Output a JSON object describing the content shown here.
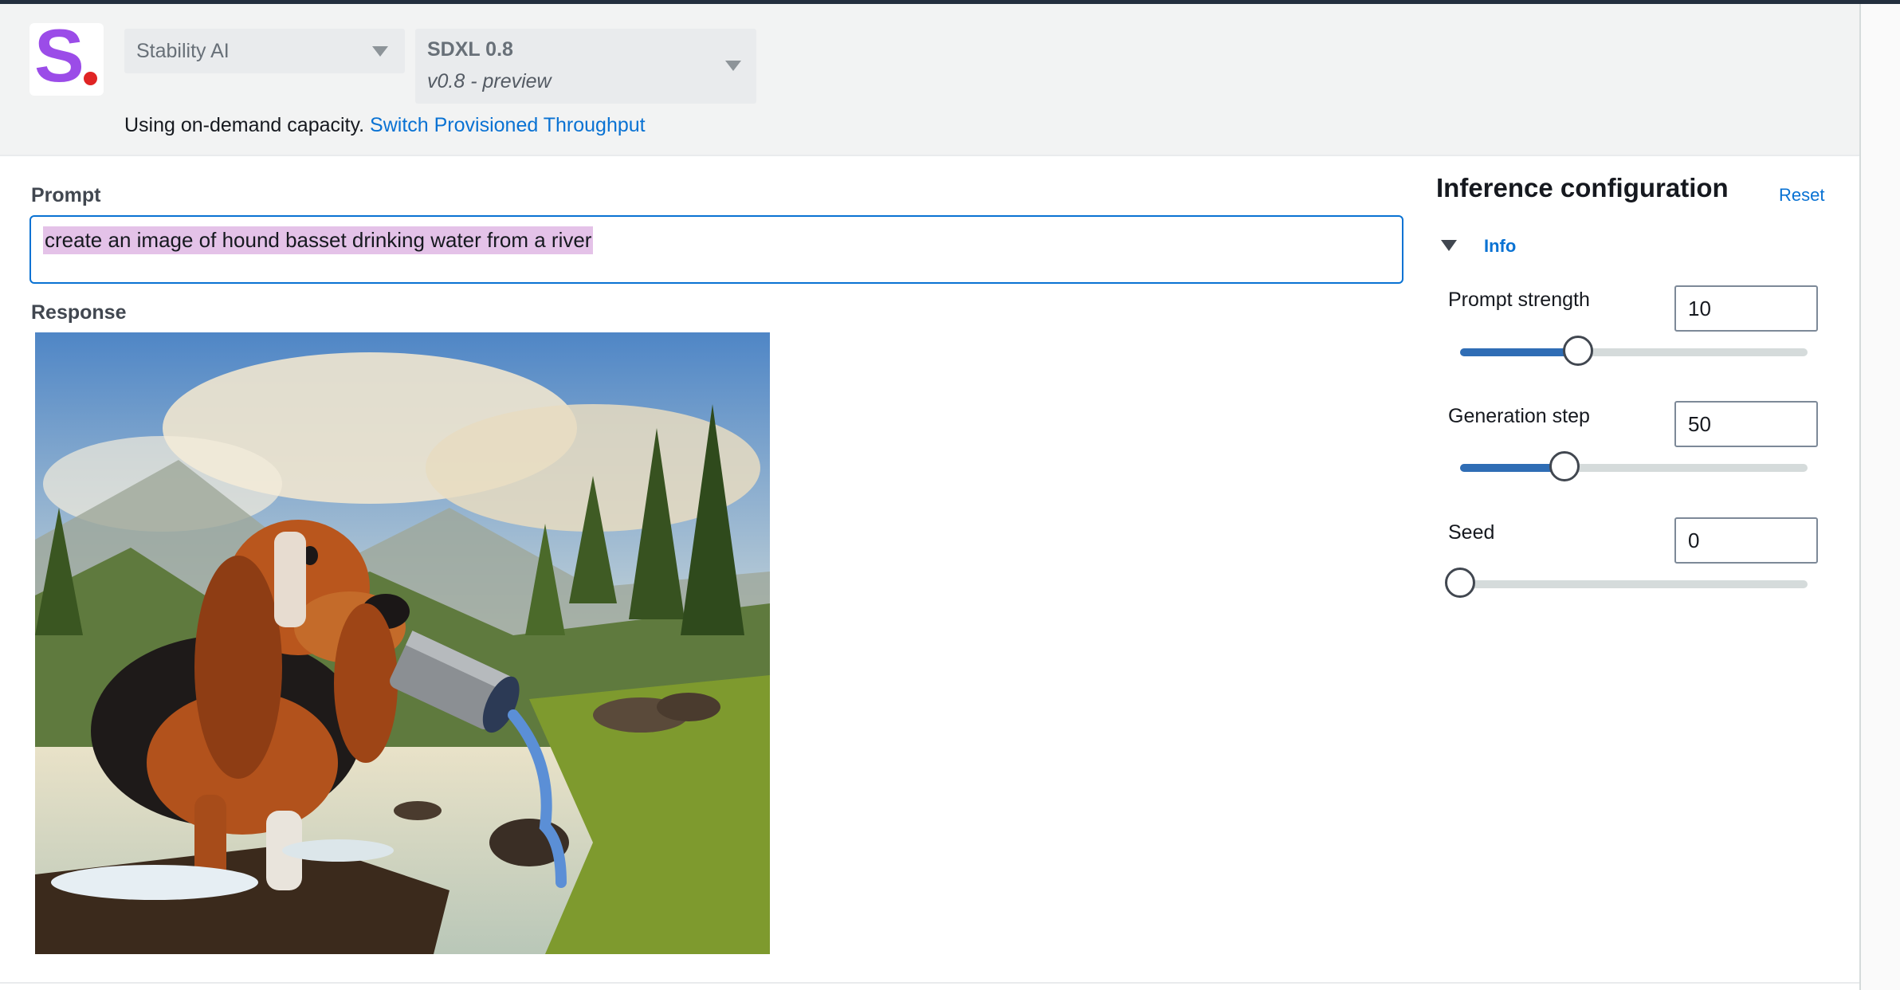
{
  "header": {
    "logo_letter": "S",
    "provider_select": {
      "value": "Stability AI"
    },
    "model_select": {
      "name": "SDXL 0.8",
      "version": "v0.8 - preview"
    },
    "capacity_text": "Using on-demand capacity.",
    "capacity_link": "Switch Provisioned Throughput"
  },
  "prompt": {
    "label": "Prompt",
    "value": "create an image of hound basset drinking water from a river"
  },
  "response": {
    "label": "Response"
  },
  "config": {
    "title": "Inference configuration",
    "reset_label": "Reset",
    "info_label": "Info",
    "params": [
      {
        "label": "Prompt strength",
        "value": "10",
        "slider_fraction": 0.34
      },
      {
        "label": "Generation step",
        "value": "50",
        "slider_fraction": 0.3
      },
      {
        "label": "Seed",
        "value": "0",
        "slider_fraction": 0.0
      }
    ]
  },
  "colors": {
    "accent": "#0972d3",
    "slider_fill": "#2f6db5",
    "logo_purple": "#9b4ce8",
    "logo_dot": "#e02424",
    "prompt_highlight": "#e4c2e8"
  }
}
